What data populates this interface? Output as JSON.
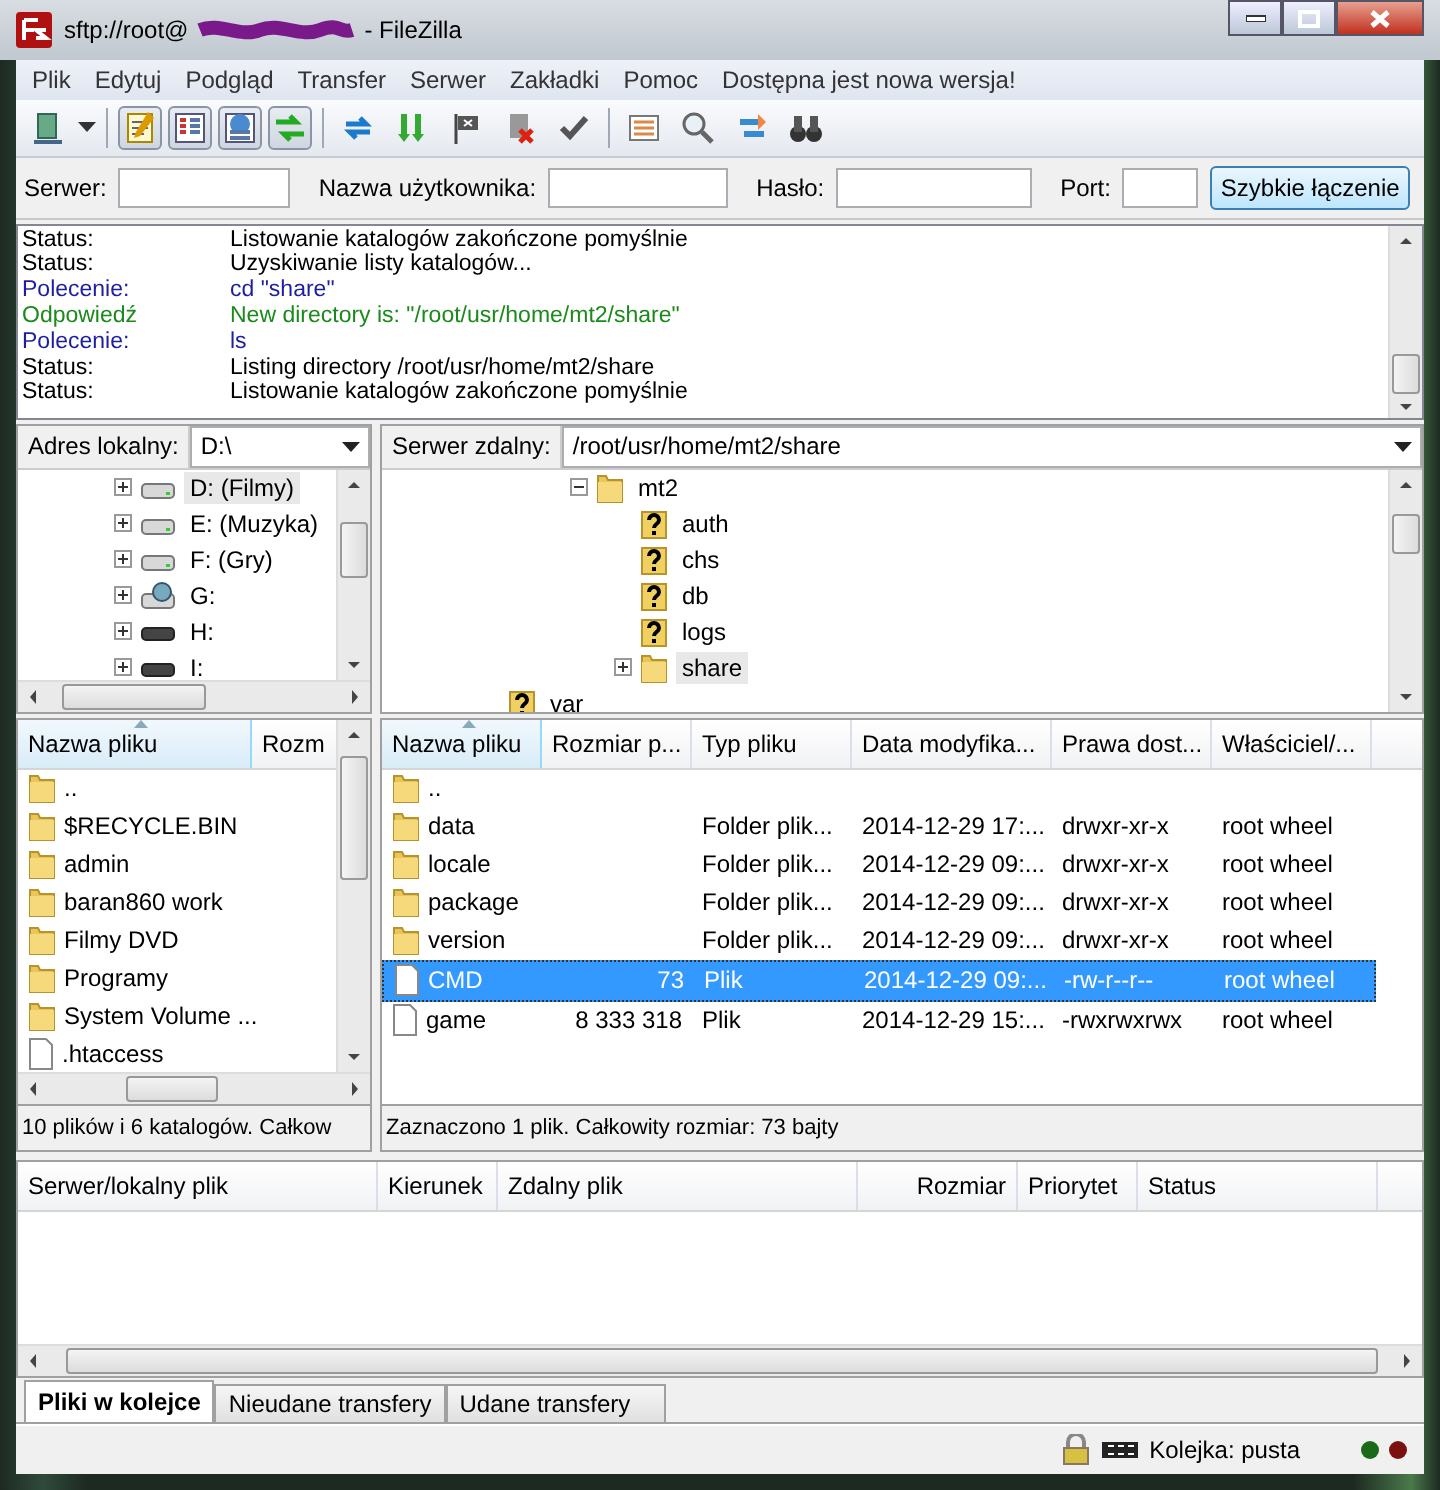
{
  "window": {
    "title_prefix": "sftp://root@",
    "title_suffix": "- FileZilla"
  },
  "menu": [
    "Plik",
    "Edytuj",
    "Podgląd",
    "Transfer",
    "Serwer",
    "Zakładki",
    "Pomoc",
    "Dostępna jest nowa wersja!"
  ],
  "toolbar": {
    "toggles": [
      {
        "kind": "log",
        "on": true
      },
      {
        "kind": "local-tree",
        "on": true
      },
      {
        "kind": "remote-tree",
        "on": true
      },
      {
        "kind": "queue",
        "on": true
      }
    ]
  },
  "quickconnect": {
    "fields": [
      {
        "label": "Serwer:"
      },
      {
        "label": "Nazwa użytkownika:"
      },
      {
        "label": "Hasło:"
      },
      {
        "label": "Port:"
      }
    ],
    "button": "Szybkie łączenie"
  },
  "log": [
    {
      "kind": "status",
      "label": "Status:",
      "text": "Listowanie katalogów zakończone pomyślnie"
    },
    {
      "kind": "status",
      "label": "Status:",
      "text": "Uzyskiwanie listy katalogów..."
    },
    {
      "kind": "command",
      "label": "Polecenie:",
      "text": "cd \"share\""
    },
    {
      "kind": "response",
      "label": "Odpowiedź",
      "text": "New directory is: \"/root/usr/home/mt2/share\""
    },
    {
      "kind": "command",
      "label": "Polecenie:",
      "text": "ls"
    },
    {
      "kind": "status",
      "label": "Status:",
      "text": "Listing directory /root/usr/home/mt2/share"
    },
    {
      "kind": "status",
      "label": "Status:",
      "text": "Listowanie katalogów zakończone pomyślnie"
    }
  ],
  "local": {
    "address_label": "Adres lokalny:",
    "address": "D:\\",
    "tree": [
      {
        "name": "D: (Filmy)",
        "kind": "drive",
        "selected": true
      },
      {
        "name": "E: (Muzyka)",
        "kind": "drive",
        "selected": false
      },
      {
        "name": "F: (Gry)",
        "kind": "drive",
        "selected": false
      },
      {
        "name": "G:",
        "kind": "network",
        "selected": false
      },
      {
        "name": "H:",
        "kind": "removable",
        "selected": false
      },
      {
        "name": "I:",
        "kind": "removable",
        "selected": false
      }
    ],
    "columns": [
      "Nazwa pliku",
      "Rozm"
    ],
    "rows": [
      {
        "name": "..",
        "kind": "folder"
      },
      {
        "name": "$RECYCLE.BIN",
        "kind": "folder"
      },
      {
        "name": "admin",
        "kind": "folder"
      },
      {
        "name": "baran860 work",
        "kind": "folder"
      },
      {
        "name": "Filmy DVD",
        "kind": "folder"
      },
      {
        "name": "Programy",
        "kind": "folder"
      },
      {
        "name": "System Volume ...",
        "kind": "folder"
      },
      {
        "name": ".htaccess",
        "kind": "file"
      }
    ],
    "status": "10 plików i 6 katalogów. Całkow"
  },
  "remote": {
    "address_label": "Serwer zdalny:",
    "address": "/root/usr/home/mt2/share",
    "tree": [
      {
        "children": [
          {
            "children": [
              {
                "name": "mt2",
                "kind": "folder",
                "expanded": true,
                "selected": false,
                "children": [
                  {
                    "name": "auth",
                    "kind": "unknown",
                    "selected": false
                  },
                  {
                    "name": "chs",
                    "kind": "unknown",
                    "selected": false
                  },
                  {
                    "name": "db",
                    "kind": "unknown",
                    "selected": false
                  },
                  {
                    "name": "logs",
                    "kind": "unknown",
                    "selected": false
                  },
                  {
                    "name": "share",
                    "kind": "folder",
                    "expanded": false,
                    "selected": true
                  }
                ]
              }
            ]
          }
        ]
      },
      {
        "name": "var",
        "kind": "unknown",
        "selected": false
      }
    ],
    "columns": [
      "Nazwa pliku",
      "Rozmiar p...",
      "Typ pliku",
      "Data modyfika...",
      "Prawa dost...",
      "Właściciel/..."
    ],
    "rows": [
      {
        "kind": "folder",
        "selected": false,
        "cells": [
          ".."
        ]
      },
      {
        "kind": "folder",
        "selected": false,
        "cells": [
          "data",
          "",
          "Folder plik...",
          "2014-12-29 17:...",
          "drwxr-xr-x",
          "root wheel"
        ]
      },
      {
        "kind": "folder",
        "selected": false,
        "cells": [
          "locale",
          "",
          "Folder plik...",
          "2014-12-29 09:...",
          "drwxr-xr-x",
          "root wheel"
        ]
      },
      {
        "kind": "folder",
        "selected": false,
        "cells": [
          "package",
          "",
          "Folder plik...",
          "2014-12-29 09:...",
          "drwxr-xr-x",
          "root wheel"
        ]
      },
      {
        "kind": "folder",
        "selected": false,
        "cells": [
          "version",
          "",
          "Folder plik...",
          "2014-12-29 09:...",
          "drwxr-xr-x",
          "root wheel"
        ]
      },
      {
        "kind": "file",
        "selected": true,
        "cells": [
          "CMD",
          "73",
          "Plik",
          "2014-12-29 09:...",
          "-rw-r--r--",
          "root wheel"
        ]
      },
      {
        "kind": "file",
        "selected": false,
        "cells": [
          "game",
          "8 333 318",
          "Plik",
          "2014-12-29 15:...",
          "-rwxrwxrwx",
          "root wheel"
        ]
      }
    ],
    "status": "Zaznaczono 1 plik. Całkowity rozmiar: 73 bajty"
  },
  "queue": {
    "columns": [
      "Serwer/lokalny plik",
      "Kierunek",
      "Zdalny plik",
      "Rozmiar",
      "Priorytet",
      "Status"
    ],
    "tabs": [
      {
        "label": "Pliki w kolejce",
        "selected": true
      },
      {
        "label": "Nieudane transfery",
        "selected": false
      },
      {
        "label": "Udane transfery",
        "selected": false
      }
    ],
    "status": "Kolejka: pusta"
  }
}
